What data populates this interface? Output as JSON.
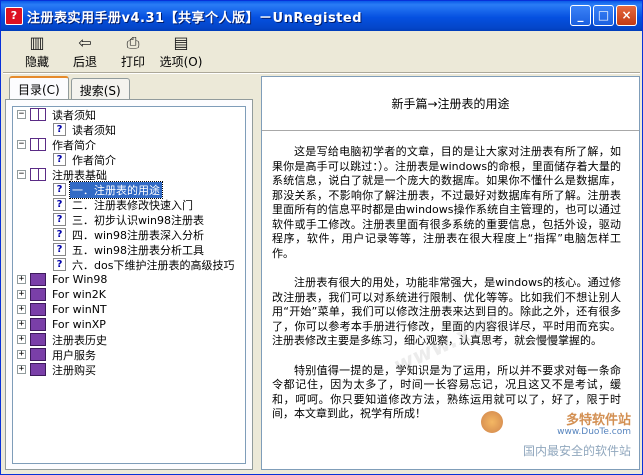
{
  "window": {
    "title": "注册表实用手册v4.31【共享个人版】－UnRegisted",
    "minimize": "_",
    "maximize": "□",
    "close": "×"
  },
  "toolbar": {
    "hide": "隐藏",
    "back": "后退",
    "print": "打印",
    "options": "选项(O)"
  },
  "tabs": {
    "contents": "目录(C)",
    "search": "搜索(S)"
  },
  "tree": [
    {
      "label": "读者须知",
      "type": "book-open",
      "expander": "−",
      "level": 0
    },
    {
      "label": "读者须知",
      "type": "topic",
      "level": 1
    },
    {
      "label": "作者简介",
      "type": "book-open",
      "expander": "−",
      "level": 0
    },
    {
      "label": "作者简介",
      "type": "topic",
      "level": 1
    },
    {
      "label": "注册表基础",
      "type": "book-open",
      "expander": "−",
      "level": 0
    },
    {
      "label": "一．注册表的用途",
      "type": "topic",
      "level": 1,
      "selected": true
    },
    {
      "label": "二．注册表修改快速入门",
      "type": "topic",
      "level": 1
    },
    {
      "label": "三．初步认识win98注册表",
      "type": "topic",
      "level": 1
    },
    {
      "label": "四．win98注册表深入分析",
      "type": "topic",
      "level": 1
    },
    {
      "label": "五．win98注册表分析工具",
      "type": "topic",
      "level": 1
    },
    {
      "label": "六．dos下维护注册表的高级技巧",
      "type": "topic",
      "level": 1
    },
    {
      "label": "For Win98",
      "type": "book-closed",
      "expander": "+",
      "level": 0
    },
    {
      "label": "For win2K",
      "type": "book-closed",
      "expander": "+",
      "level": 0
    },
    {
      "label": "For winNT",
      "type": "book-closed",
      "expander": "+",
      "level": 0
    },
    {
      "label": "For winXP",
      "type": "book-closed",
      "expander": "+",
      "level": 0
    },
    {
      "label": "注册表历史",
      "type": "book-closed",
      "expander": "+",
      "level": 0
    },
    {
      "label": "用户服务",
      "type": "book-closed",
      "expander": "+",
      "level": 0
    },
    {
      "label": "注册购买",
      "type": "book-closed",
      "expander": "+",
      "level": 0
    }
  ],
  "content": {
    "header": "新手篇→注册表的用途",
    "paragraphs": [
      "这是写给电脑初学者的文章，目的是让大家对注册表有所了解，如果你是高手可以跳过：）。注册表是windows的命根，里面储存着大量的系统信息，说白了就是一个庞大的数据库。如果你不懂什么是数据库，那没关系，不影响你了解注册表，不过最好对数据库有所了解。注册表里面所有的信息平时都是由windows操作系统自主管理的，也可以通过软件或手工修改。注册表里面有很多系统的重要信息，包括外设，驱动程序，软件，用户记录等等，注册表在很大程度上“指挥”电脑怎样工作。",
      "注册表有很大的用处，功能非常强大，是windows的核心。通过修改注册表，我们可以对系统进行限制、优化等等。比如我们不想让别人用“开始”菜单，我们可以修改注册表来达到目的。除此之外，还有很多了，你可以参考本手册进行修改，里面的内容很详尽，平时用而充实。注册表修改主要是多练习，细心观察，认真思考，就会慢慢掌握的。",
      "特别值得一提的是，学知识是为了运用，所以并不要求对每一条命令都记住，因为太多了，时间一长容易忘记，况且这又不是考试，缓和，呵呵。你只要知道修改方法，熟练运用就可以了，好了，限于时间，本文章到此，祝学有所成！"
    ]
  },
  "watermark": {
    "site_cn": "多特软件站",
    "site_url": "www.DuoTe.com",
    "slogan": "国内最安全的软件站",
    "overlay": "www.xxx"
  },
  "colors": {
    "titlebar": "#0550e0",
    "selection": "#316ac5",
    "book": "#7a3fa8"
  }
}
